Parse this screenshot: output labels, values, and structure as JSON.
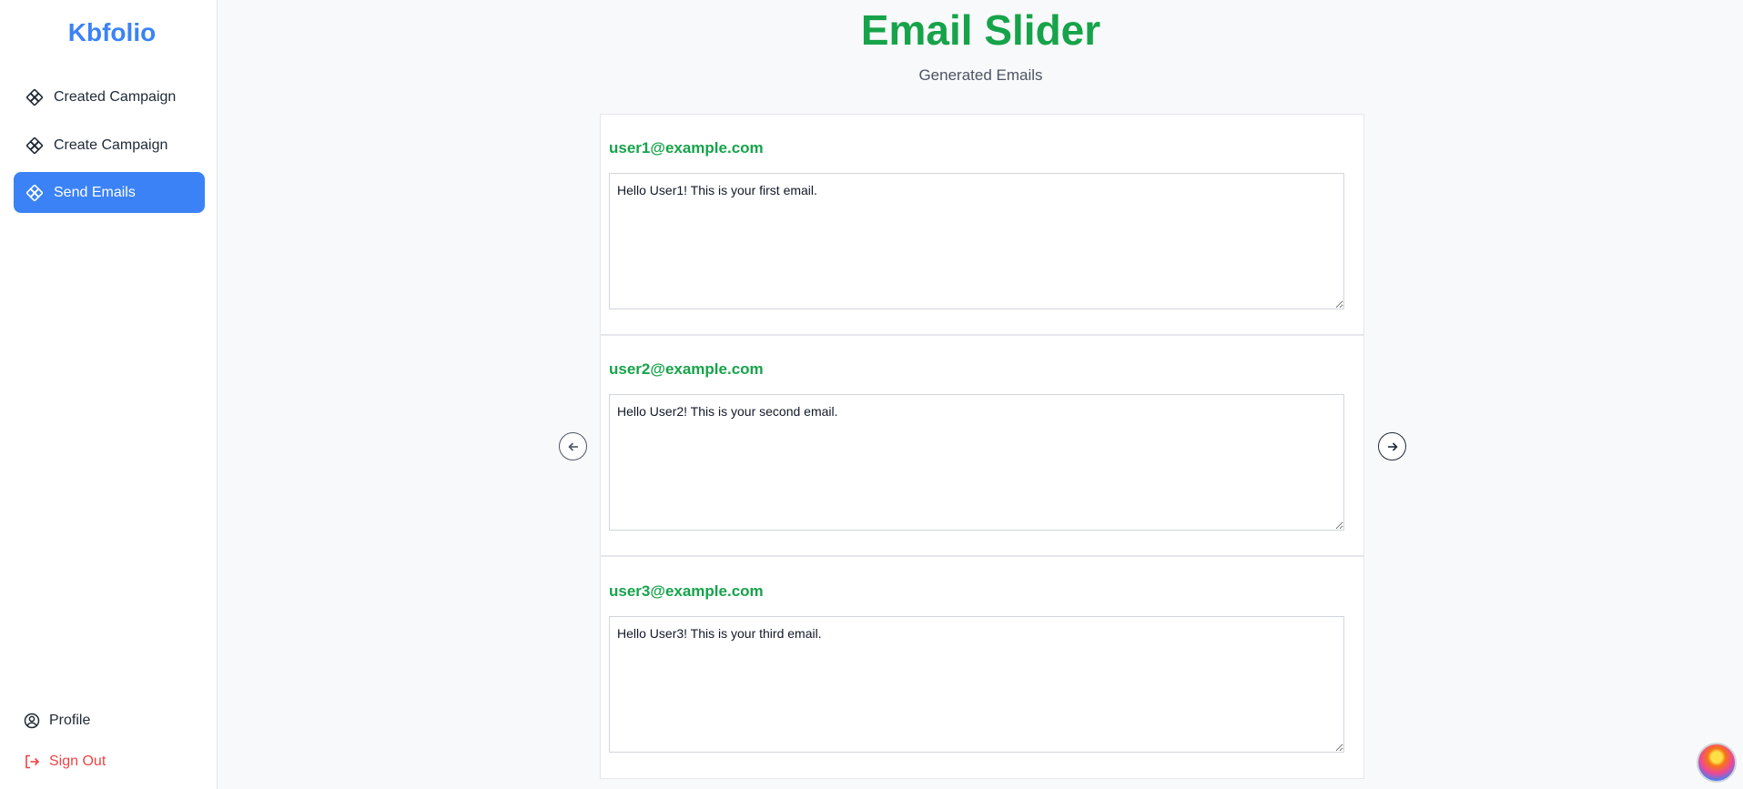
{
  "brand": "Kbfolio",
  "sidebar": {
    "items": [
      {
        "label": "Created Campaign",
        "icon": "diamond-grid-icon"
      },
      {
        "label": "Create Campaign",
        "icon": "diamond-grid-icon"
      },
      {
        "label": "Send Emails",
        "icon": "diamond-grid-icon",
        "active": true
      }
    ],
    "profile_label": "Profile",
    "signout_label": "Sign Out"
  },
  "page": {
    "title": "Email Slider",
    "subtitle": "Generated Emails"
  },
  "emails": [
    {
      "address": "user1@example.com",
      "body": "Hello User1! This is your first email."
    },
    {
      "address": "user2@example.com",
      "body": "Hello User2! This is your second email."
    },
    {
      "address": "user3@example.com",
      "body": "Hello User3! This is your third email."
    }
  ],
  "colors": {
    "accent_blue": "#3b82f6",
    "accent_green": "#16a34a",
    "signout_red": "#ef4444"
  }
}
